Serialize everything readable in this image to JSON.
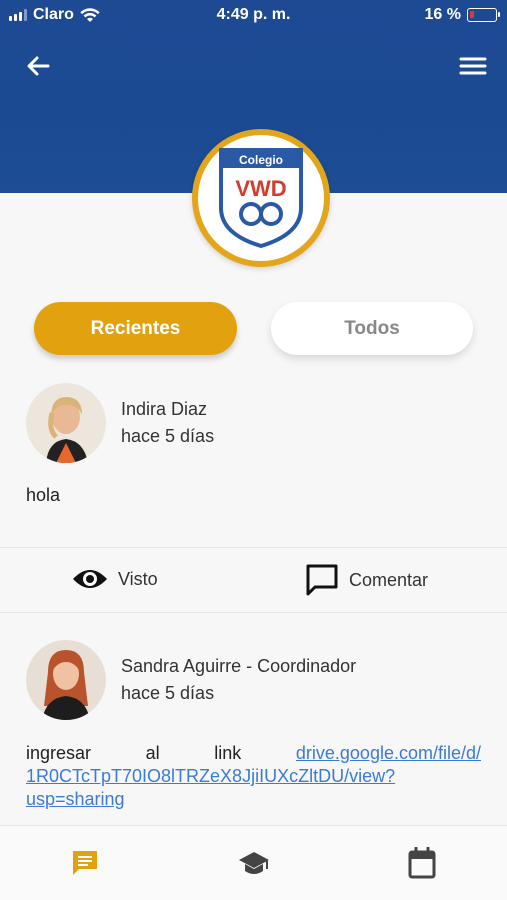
{
  "status_bar": {
    "carrier": "Claro",
    "time": "4:49 p. m.",
    "battery_percent": "16 %",
    "battery_level": 0.16
  },
  "header": {
    "back_icon": "arrow-left-icon",
    "menu_icon": "hamburger-menu-icon",
    "logo": {
      "top_text": "Colegio",
      "initials": "VWD"
    },
    "colors": {
      "header_bg": "#1b4a92",
      "accent": "#e2a20f"
    }
  },
  "tabs": [
    {
      "label": "Recientes",
      "active": true
    },
    {
      "label": "Todos",
      "active": false
    }
  ],
  "posts": [
    {
      "author": "Indira Diaz",
      "time": "hace 5 días",
      "body": "hola",
      "actions": {
        "seen": "Visto",
        "comment": "Comentar"
      }
    },
    {
      "author": "Sandra Aguirre - Coordinador",
      "time": "hace 5 días",
      "body_words": [
        "ingresar",
        "al",
        "link"
      ],
      "link_line1": "drive.google.com/file/d/",
      "link_line2": "1R0CTcTpT70IO8lTRZeX8JjiIUXcZltDU/view?",
      "link_line3": "usp=sharing"
    }
  ],
  "bottom_nav": [
    {
      "icon": "message-icon",
      "active": true
    },
    {
      "icon": "graduation-cap-icon",
      "active": false
    },
    {
      "icon": "calendar-icon",
      "active": false
    }
  ]
}
